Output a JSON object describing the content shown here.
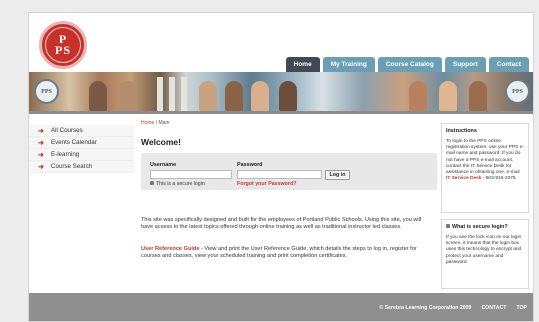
{
  "logo": {
    "line1": "P",
    "line2": "PS"
  },
  "tabs": [
    {
      "label": "Home"
    },
    {
      "label": "My Training"
    },
    {
      "label": "Course Catalog"
    },
    {
      "label": "Support"
    },
    {
      "label": "Contact"
    }
  ],
  "banner": {
    "seal_text": "PPS"
  },
  "sidebar": {
    "items": [
      {
        "label": "All Courses"
      },
      {
        "label": "Events Calendar"
      },
      {
        "label": "E-learning"
      },
      {
        "label": "Course Search"
      }
    ]
  },
  "breadcrumb": {
    "home": "Home",
    "separator": " / ",
    "current": "Main"
  },
  "main": {
    "title": "Welcome!",
    "login": {
      "username_label": "Username",
      "password_label": "Password",
      "button_label": "Log in",
      "secure_note": "This is a secure login",
      "forgot_label": "Forgot your Password?"
    },
    "intro": "This site was specifically designed and built for the employees of Portland Public Schools. Using this site, you will have access to the latest topics offered through online training as well as traditional instructor led classes.",
    "guide_link": "User Reference Guide",
    "guide_text": " - View and print the User Reference Guide, which details the steps to log in, register for courses and classes, view your scheduled training and print completion certificates."
  },
  "instructions": {
    "title": "Instructions",
    "text": "To login to the PPS online registration system, use your PPS e-mail name and password. If you do not have a PPS e-mail account, contact the IT Service Desk for assistance in obtaining one, e-mail",
    "link": "IT Service Desk",
    "phone": " - 503-916-3375."
  },
  "secure_info": {
    "title": "What is secure login?",
    "text": "If you see the lock icon on our login screen, it means that the login box uses this technology to encrypt and protect your username and password."
  },
  "footer": {
    "copyright": "© Serebra Learning Corporation 2009",
    "contact": "CONTACT",
    "top": "TOP"
  },
  "colors": {
    "accent_red": "#c0392b",
    "tab_blue": "#6b9fb5",
    "tab_active": "#3f4a55",
    "footer": "#8f8f8f"
  }
}
